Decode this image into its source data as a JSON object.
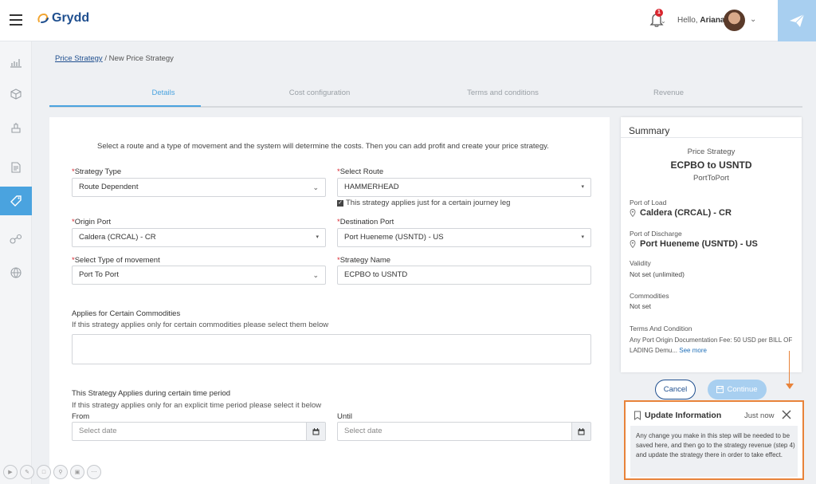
{
  "app": {
    "brand": "Grydd",
    "greeting": "Hello,",
    "user_name": "Ariana",
    "notification_count": "1"
  },
  "breadcrumb": {
    "parent": "Price Strategy",
    "separator": "/",
    "current": "New Price Strategy"
  },
  "steps": [
    {
      "label": "Details"
    },
    {
      "label": "Cost configuration"
    },
    {
      "label": "Terms and conditions"
    },
    {
      "label": "Revenue"
    }
  ],
  "form": {
    "intro": "Select a route and a type of movement and the system will determine the costs. Then you can add profit and create your price strategy.",
    "required_mark": "*",
    "strategy_type": {
      "label": "Strategy Type",
      "value": "Route Dependent"
    },
    "select_route": {
      "label": "Select Route",
      "value": "HAMMERHEAD"
    },
    "journey_leg_check": "This strategy applies just for a certain journey leg",
    "origin_port": {
      "label": "Origin Port",
      "value": "Caldera (CRCAL) - CR"
    },
    "destination_port": {
      "label": "Destination Port",
      "value": "Port Hueneme (USNTD) - US"
    },
    "movement_type": {
      "label": "Select Type of movement",
      "value": "Port To Port"
    },
    "strategy_name": {
      "label": "Strategy Name",
      "value": "ECPBO to USNTD"
    },
    "commodities": {
      "title": "Applies for Certain Commodities",
      "subtitle": "If this strategy applies only for certain commodities please select them below"
    },
    "time_period": {
      "title": "This Strategy Applies during certain time period",
      "subtitle": "If this strategy applies only for an explicit time period please select it below",
      "from_label": "From",
      "until_label": "Until",
      "from_placeholder": "Select date",
      "until_placeholder": "Select date"
    }
  },
  "summary": {
    "title": "Summary",
    "kind": "Price Strategy",
    "name": "ECPBO to USNTD",
    "movement": "PortToPort",
    "port_of_load_label": "Port of Load",
    "port_of_load": "Caldera (CRCAL) - CR",
    "port_of_discharge_label": "Port of Discharge",
    "port_of_discharge": "Port Hueneme (USNTD) - US",
    "validity_label": "Validity",
    "validity": "Not set (unlimited)",
    "commodities_label": "Commodities",
    "commodities": "Not set",
    "terms_label": "Terms And Condition",
    "terms_text": "Any Port Origin Documentation Fee: 50 USD per BILL OF LADING Demu...",
    "see_more": "See more"
  },
  "actions": {
    "cancel": "Cancel",
    "continue": "Continue"
  },
  "toast": {
    "title": "Update Information",
    "time": "Just now",
    "body": "Any change you make in this step will be needed to be saved here, and then go to the strategy revenue (step 4) and update the strategy there in order to take effect."
  },
  "colors": {
    "accent": "#4aa3df",
    "brand": "#1f4f8f",
    "required": "#d9262f",
    "highlight": "#e8833a",
    "continue_disabled": "#a8cff0"
  }
}
